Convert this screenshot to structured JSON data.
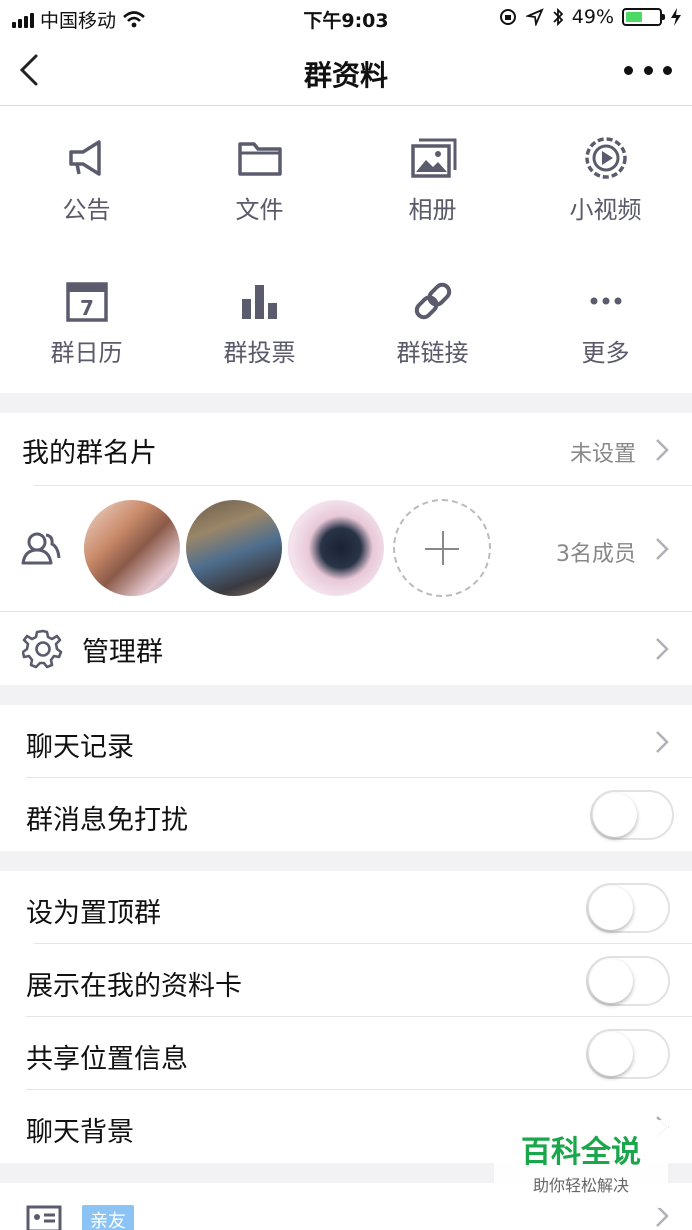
{
  "status_bar": {
    "carrier": "中国移动",
    "time": "下午9:03",
    "battery": "49%",
    "battery_level": 0.49
  },
  "nav": {
    "title": "群资料"
  },
  "grid": {
    "items": [
      {
        "label": "公告",
        "icon": "megaphone-icon"
      },
      {
        "label": "文件",
        "icon": "folder-icon"
      },
      {
        "label": "相册",
        "icon": "photo-album-icon"
      },
      {
        "label": "小视频",
        "icon": "video-icon"
      },
      {
        "label": "群日历",
        "icon": "calendar-icon",
        "icon_text": "7"
      },
      {
        "label": "群投票",
        "icon": "poll-icon"
      },
      {
        "label": "群链接",
        "icon": "link-icon"
      },
      {
        "label": "更多",
        "icon": "more-icon"
      }
    ]
  },
  "card": {
    "nickname_label": "我的群名片",
    "nickname_value": "未设置",
    "members_value": "3名成员",
    "manage_label": "管理群"
  },
  "chat": {
    "history_label": "聊天记录",
    "mute_label": "群消息免打扰",
    "mute_on": false
  },
  "settings": {
    "pin_label": "设为置顶群",
    "pin_on": false,
    "show_label": "展示在我的资料卡",
    "show_on": false,
    "location_label": "共享位置信息",
    "location_on": false,
    "background_label": "聊天背景"
  },
  "bottom": {
    "tag": "亲友"
  },
  "watermark": {
    "title": "百科全说",
    "subtitle": "助你轻松解决"
  }
}
